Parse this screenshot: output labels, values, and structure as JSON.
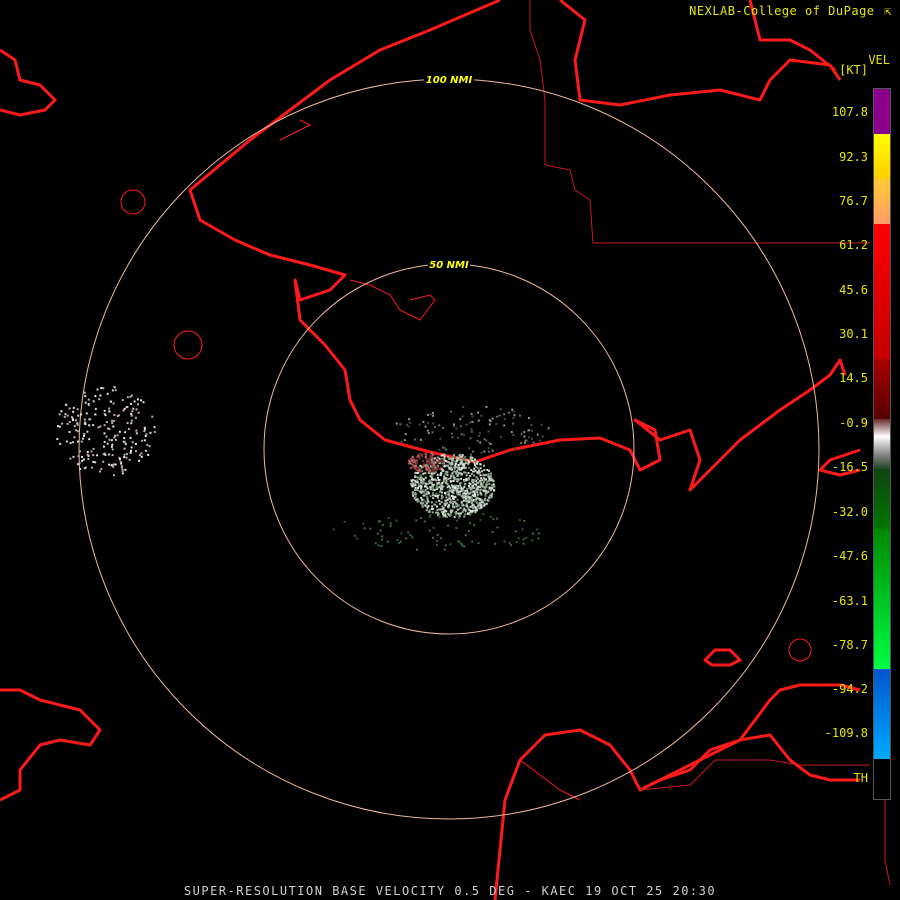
{
  "credit": {
    "text": "NEXLAB-College of DuPage",
    "icon": "corner-arrow-icon"
  },
  "footer": {
    "text": "SUPER-RESOLUTION BASE VELOCITY 0.5 DEG - KAEC 19 OCT 25 20:30"
  },
  "legend": {
    "title": "VEL",
    "unit": "[KT]",
    "ticks": [
      "107.8",
      "92.3",
      "76.7",
      "61.2",
      "45.6",
      "30.1",
      "14.5",
      "-0.9",
      "-16.5",
      "-32.0",
      "-47.6",
      "-63.1",
      "-78.7",
      "-94.2",
      "-109.8",
      "TH"
    ]
  },
  "rings": [
    {
      "label": "50 NMI"
    },
    {
      "label": "100 NMI"
    }
  ],
  "colors": {
    "coastline": "#ff1a1a",
    "boundary": "#cc1a1a",
    "ring": "#f0b8a0",
    "label": "#e6e600"
  }
}
